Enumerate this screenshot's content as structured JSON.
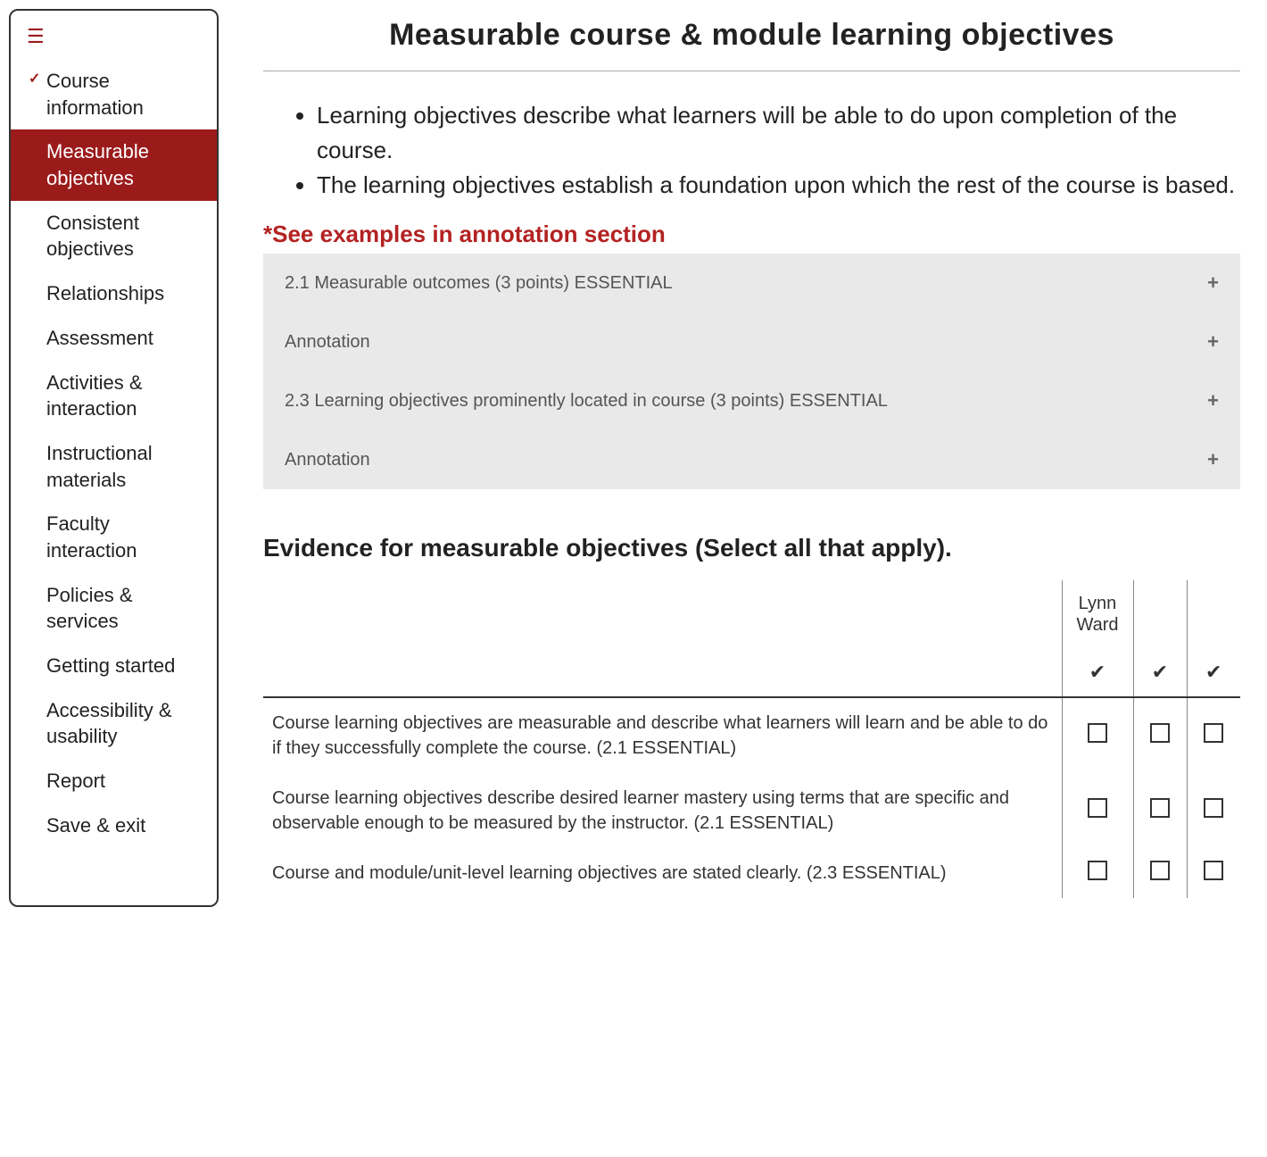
{
  "sidebar": {
    "items": [
      {
        "label": "Course information",
        "completed": true,
        "active": false
      },
      {
        "label": "Measurable objectives",
        "completed": false,
        "active": true
      },
      {
        "label": "Consistent objectives",
        "completed": false,
        "active": false
      },
      {
        "label": "Relationships",
        "completed": false,
        "active": false
      },
      {
        "label": "Assessment",
        "completed": false,
        "active": false
      },
      {
        "label": "Activities & interaction",
        "completed": false,
        "active": false
      },
      {
        "label": "Instructional materials",
        "completed": false,
        "active": false
      },
      {
        "label": "Faculty interaction",
        "completed": false,
        "active": false
      },
      {
        "label": "Policies & services",
        "completed": false,
        "active": false
      },
      {
        "label": "Getting started",
        "completed": false,
        "active": false
      },
      {
        "label": "Accessibility & usability",
        "completed": false,
        "active": false
      },
      {
        "label": "Report",
        "completed": false,
        "active": false
      },
      {
        "label": "Save & exit",
        "completed": false,
        "active": false
      }
    ]
  },
  "page": {
    "title": "Measurable course & module learning objectives",
    "bullets": [
      "Learning objectives describe what learners will be able to do upon completion of the course.",
      "The learning objectives establish a foundation upon which the rest of the course is based."
    ],
    "see_examples": "*See examples in annotation section",
    "accordion": [
      {
        "label": "2.1 Measurable outcomes (3 points) ESSENTIAL"
      },
      {
        "label": "Annotation"
      },
      {
        "label": "2.3 Learning objectives prominently located in course (3 points) ESSENTIAL"
      },
      {
        "label": "Annotation"
      }
    ],
    "evidence_heading": "Evidence for measurable objectives (Select all that apply).",
    "table": {
      "reviewers": [
        "Lynn Ward",
        "",
        ""
      ],
      "check_symbol": "✔",
      "rows": [
        "Course learning objectives are measurable and describe what learners will learn and be able to do if they successfully complete the course. (2.1 ESSENTIAL)",
        "Course learning objectives describe desired learner mastery using terms that are specific and observable enough to be measured by the instructor. (2.1 ESSENTIAL)",
        "Course and module/unit-level learning objectives are stated clearly. (2.3 ESSENTIAL)"
      ]
    }
  }
}
